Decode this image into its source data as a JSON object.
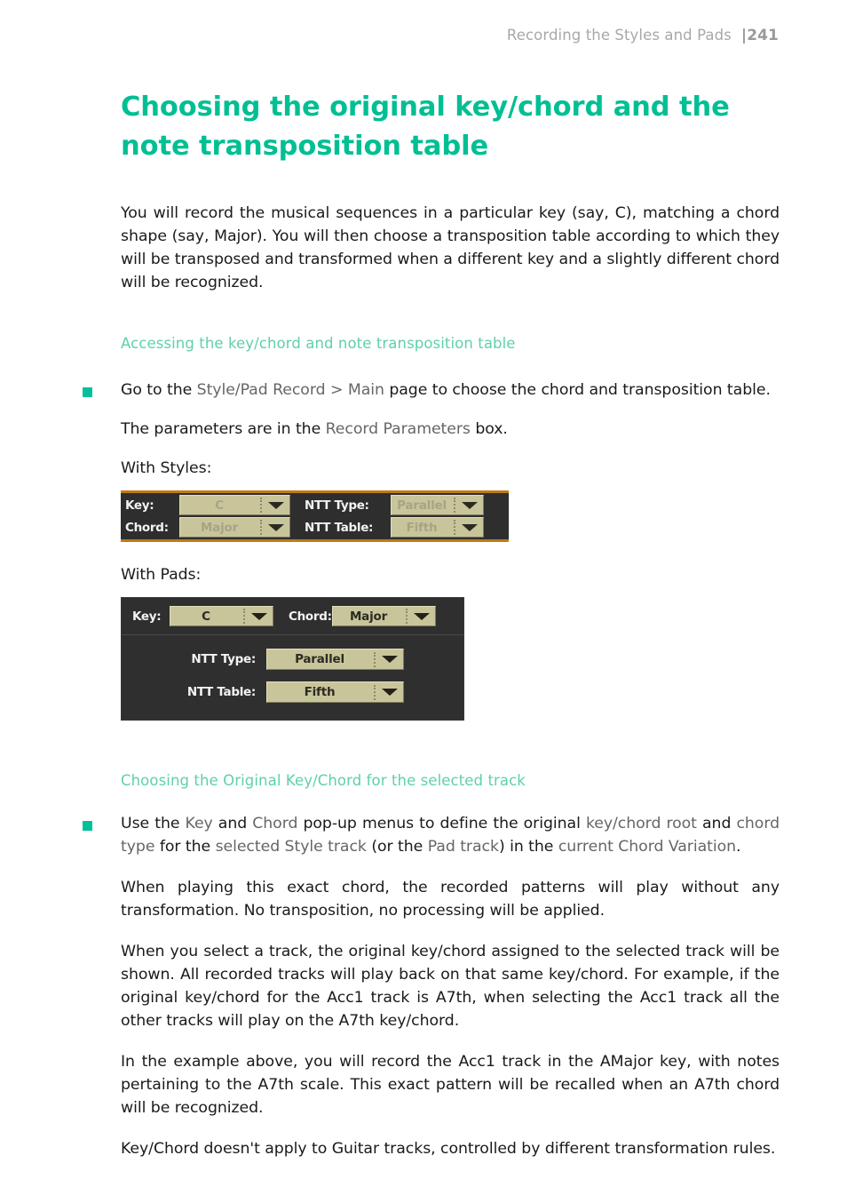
{
  "header": {
    "running_title": "Recording the Styles and Pads",
    "page_number": "241",
    "page_separator": "|"
  },
  "chapter": {
    "title": "Choosing the original key/chord and the note transposition table",
    "intro": "You will record the musical sequences in a particular key (say, C), matching a chord shape (say, Major). You will then choose a transposition table according to which they will be transposed and transformed when a different key and a slightly different chord will be recognized."
  },
  "section_access": {
    "heading": "Accessing the key/chord and note transposition table",
    "bullet": {
      "pre": "Go to the ",
      "term1": "Style/Pad Record",
      "mid": " > ",
      "term2": "Main",
      "post": " page to choose the chord and transposition table."
    },
    "parameters_line": {
      "pre": "The parameters are in the ",
      "term": "Record Parameters",
      "post": " box."
    },
    "with_styles_label": "With Styles:",
    "with_pads_label": "With Pads:"
  },
  "styles_widget": {
    "rows": [
      {
        "label": "Key:",
        "value": "C"
      },
      {
        "label": "Chord:",
        "value": "Major"
      },
      {
        "label": "NTT Type:",
        "value": "Parallel"
      },
      {
        "label": "NTT Table:",
        "value": "Fifth"
      }
    ],
    "colors": {
      "panel_bg": "#2e2e2e",
      "accent_border": "#c07a14",
      "combo_bg": "#c9c59a",
      "combo_text_dim": "#a6a487",
      "label_text": "#f2f2f2"
    }
  },
  "pads_widget": {
    "top_row": [
      {
        "label": "Key:",
        "value": "C"
      },
      {
        "label": "Chord:",
        "value": "Major"
      }
    ],
    "bottom_rows": [
      {
        "label": "NTT Type:",
        "value": "Parallel"
      },
      {
        "label": "NTT Table:",
        "value": "Fifth"
      }
    ],
    "colors": {
      "panel_bg": "#2f2f2f",
      "combo_bg": "#c9c59a",
      "combo_text": "#2b2b22",
      "label_text": "#f2f2f2"
    }
  },
  "section_choosing": {
    "heading": "Choosing the Original Key/Chord for the selected track",
    "bullet": {
      "s1": "Use the ",
      "t1": "Key",
      "s2": " and ",
      "t2": "Chord",
      "s3": " pop-up menus to define the original ",
      "t3": "key/chord root",
      "s4": " and ",
      "t4": "chord type",
      "s5": " for the ",
      "t5": "selected Style track",
      "s6": " (or the ",
      "t6": "Pad track",
      "s7": ") in the ",
      "t7": "current Chord Variation",
      "s8": "."
    },
    "paragraphs": [
      "When playing this exact chord, the recorded patterns will play without any transformation. No transposition, no processing will be applied.",
      "When you select a track, the original key/chord assigned to the selected track will be shown. All recorded tracks will play back on that same key/chord. For example, if the original key/chord for the Acc1 track is A7th, when selecting the Acc1 track all the other tracks will play on the A7th key/chord.",
      "In the example above, you will record the Acc1 track in the AMajor key, with notes pertaining to the A7th scale. This exact pattern will be recalled when an A7th chord will be recognized.",
      "Key/Chord doesn't apply to Guitar tracks, controlled by different transformation rules."
    ]
  },
  "colors": {
    "title_teal": "#00bf93",
    "subhead_teal": "#5ed0ab",
    "bullet_teal": "#00c19a",
    "ui_term_gray": "#666666",
    "body_black": "#1a1a1a",
    "header_gray": "#a8a8a8"
  }
}
